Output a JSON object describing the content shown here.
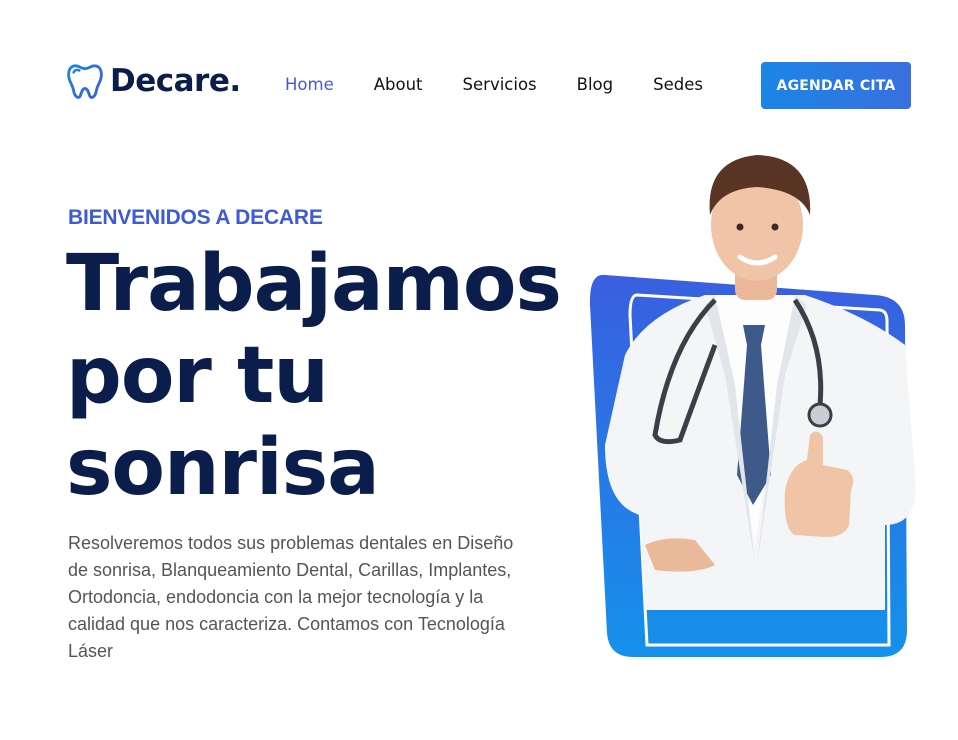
{
  "brand": {
    "name": "Decare.",
    "logo_icon": "tooth-icon",
    "accent_color": "#3d5bd6",
    "dark_color": "#0b1d4a"
  },
  "nav": {
    "items": [
      {
        "label": "Home",
        "active": true
      },
      {
        "label": "About",
        "active": false
      },
      {
        "label": "Servicios",
        "active": false
      },
      {
        "label": "Blog",
        "active": false
      },
      {
        "label": "Sedes",
        "active": false
      }
    ]
  },
  "cta": {
    "label": "AGENDAR CITA",
    "color": "#1a86e6"
  },
  "hero": {
    "eyebrow": "BIENVENIDOS A DECARE",
    "headline_lines": [
      "Trabajamos",
      "por tu",
      "sonrisa"
    ],
    "description": "Resolveremos todos sus problemas dentales en Diseño de sonrisa, Blanqueamiento Dental, Carillas, Implantes, Ortodoncia, endodoncia con la mejor tecnología y la calidad que nos caracteriza. Contamos con Tecnología Láser",
    "image": "doctor-thumbs-up-illustration"
  }
}
